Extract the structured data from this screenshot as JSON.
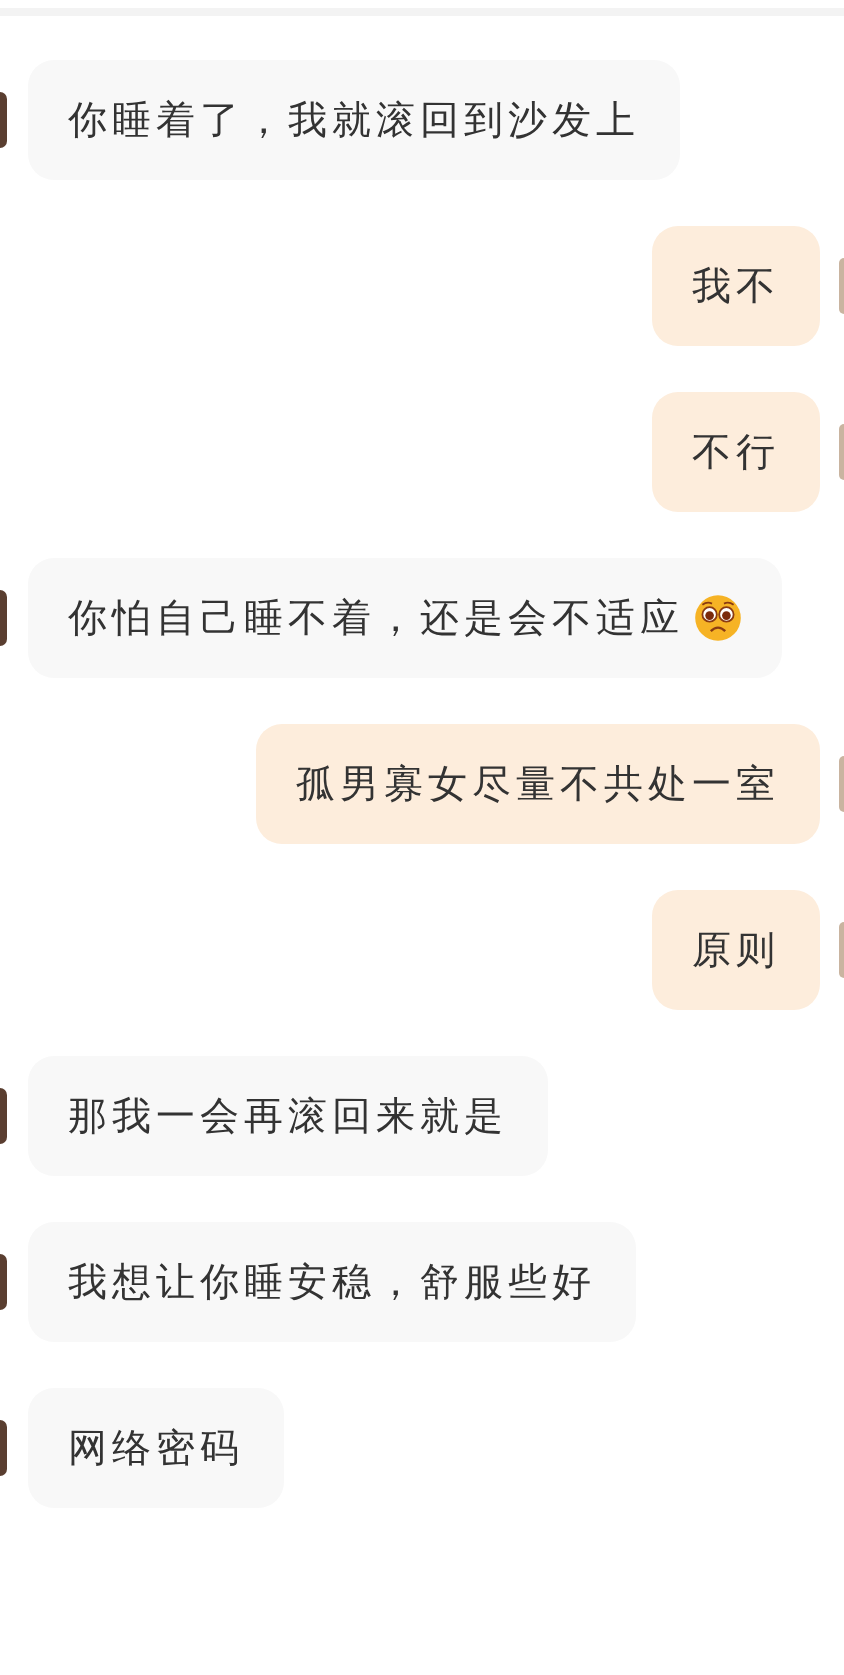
{
  "messages": [
    {
      "kind": "received",
      "text": "你睡着了，我就滚回到沙发上"
    },
    {
      "kind": "sent",
      "text": "我不"
    },
    {
      "kind": "sent",
      "text": "不行"
    },
    {
      "kind": "received",
      "text": "你怕自己睡不着，还是会不适应",
      "has_emoji": true
    },
    {
      "kind": "sent",
      "text": "孤男寡女尽量不共处一室"
    },
    {
      "kind": "sent",
      "text": "原则"
    },
    {
      "kind": "received",
      "text": "那我一会再滚回来就是"
    },
    {
      "kind": "received",
      "text": "我想让你睡安稳，舒服些好"
    },
    {
      "kind": "received",
      "text": "网络密码"
    }
  ]
}
